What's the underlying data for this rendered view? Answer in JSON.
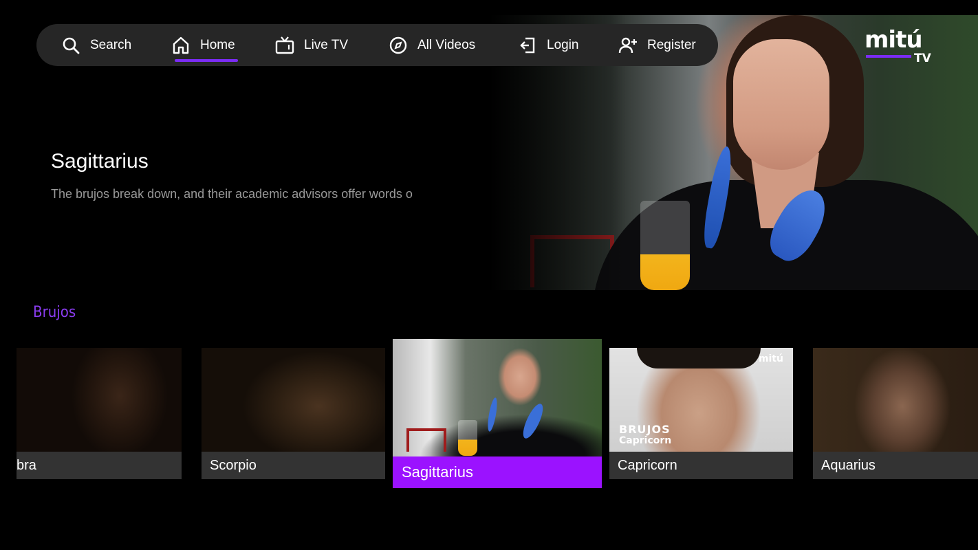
{
  "nav": {
    "items": [
      {
        "label": "Search",
        "icon": "search-icon"
      },
      {
        "label": "Home",
        "icon": "home-icon",
        "active": true
      },
      {
        "label": "Live TV",
        "icon": "tv-icon"
      },
      {
        "label": "All Videos",
        "icon": "compass-icon"
      },
      {
        "label": "Login",
        "icon": "login-icon"
      },
      {
        "label": "Register",
        "icon": "add-user-icon"
      }
    ],
    "accent_color": "#7b2cf5"
  },
  "logo": {
    "word": "mitú",
    "suffix": "TV"
  },
  "hero": {
    "title": "Sagittarius",
    "description": "The brujos break down, and their academic advisors offer words o"
  },
  "row": {
    "title": "Brujos",
    "title_color": "#8a3cf0",
    "cards": [
      {
        "label": "bra"
      },
      {
        "label": "Scorpio"
      },
      {
        "label": "Sagittarius",
        "focused": true
      },
      {
        "label": "Capricorn",
        "overlay_title": "BRUJOS",
        "overlay_subtitle": "Capricorn",
        "watermark": "mitú"
      },
      {
        "label": "Aquarius"
      }
    ],
    "focus_color": "#9b12ff"
  }
}
